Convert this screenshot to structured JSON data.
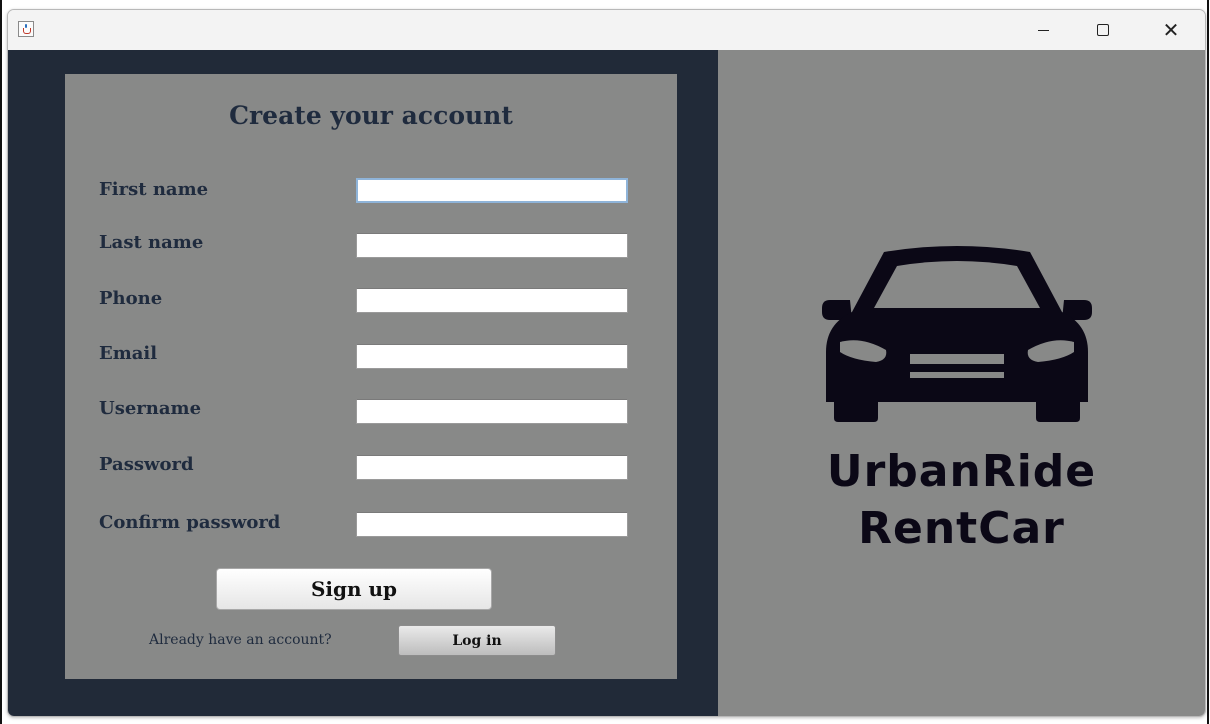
{
  "window": {
    "icon": "java-cup-icon",
    "controls": {
      "minimize": "minimize-icon",
      "maximize": "maximize-icon",
      "close_glyph": "✕"
    }
  },
  "form": {
    "title": "Create your account",
    "fields": [
      {
        "label": "First name",
        "value": "",
        "focused": true
      },
      {
        "label": "Last name",
        "value": ""
      },
      {
        "label": "Phone",
        "value": ""
      },
      {
        "label": "Email",
        "value": ""
      },
      {
        "label": "Username",
        "value": ""
      },
      {
        "label": "Password",
        "value": ""
      },
      {
        "label": "Confirm password",
        "value": ""
      }
    ],
    "signup_label": "Sign up",
    "already_text": "Already have an account?",
    "login_label": "Log in"
  },
  "brand": {
    "line1": "UrbanRide",
    "line2": "RentCar",
    "logo_icon": "car-icon"
  },
  "colors": {
    "left_panel": "#212a38",
    "card": "#888988",
    "right_panel": "#888988",
    "text": "#1f2b3e",
    "logo": "#0b0816"
  }
}
